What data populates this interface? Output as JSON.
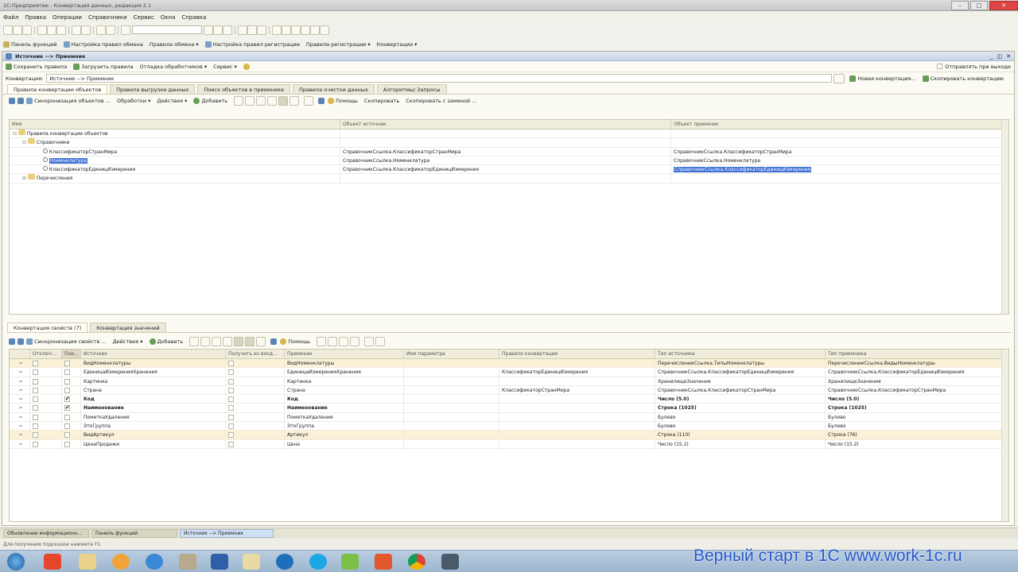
{
  "window": {
    "title": "1С:Предприятие - Конвертация данных, редакция 2.1"
  },
  "menu": [
    "Файл",
    "Правка",
    "Операции",
    "Справочники",
    "Сервис",
    "Окна",
    "Справка"
  ],
  "toolbar2": [
    "Панель функций",
    "Настройка правил обмена",
    "Правила обмена ▾",
    "Настройка правил регистрации",
    "Правила регистрации ▾",
    "Конвертации ▾"
  ],
  "doc": {
    "title": "Источник --> Приемник",
    "actions": [
      "Сохранить правила",
      "Загрузить правила",
      "Отладка обработчиков ▾",
      "Сервис ▾"
    ],
    "send_on_exit": "Отправлять при выходе",
    "conv_label": "Конвертация:",
    "conv_value": "Источник --> Приемник",
    "new_conv": "Новая конвертация...",
    "copy_conv": "Скопировать конвертацию",
    "tabs": [
      "Правила конвертации объектов",
      "Правила выгрузки данных",
      "Поиск объектов в приемнике",
      "Правила очистки данных",
      "Алгоритмы/ Запросы"
    ],
    "tree_toolbar": [
      "Синхронизация объектов ...",
      "Обработки ▾",
      "Действия ▾",
      "Добавить",
      "Помощь",
      "Скопировать",
      "Скопировать с заменой ..."
    ],
    "tree_headers": [
      "Имя",
      "Объект источник",
      "Объект приемник"
    ],
    "tree_rows": [
      {
        "name": "Правила конвертации объектов",
        "src": "",
        "dst": ""
      },
      {
        "name": "Справочники",
        "src": "",
        "dst": ""
      },
      {
        "name": "КлассификаторСтранМира",
        "src": "СправочникСсылка.КлассификаторСтранМира",
        "dst": "СправочникСсылка.КлассификаторСтранМира"
      },
      {
        "name": "Номенклатура",
        "src": "СправочникСсылка.Номенклатура",
        "dst": "СправочникСсылка.Номенклатура"
      },
      {
        "name": "КлассификаторЕдиницИзмерения",
        "src": "СправочникСсылка.КлассификаторЕдиницИзмерения",
        "dst": "СправочникСсылка.КлассификаторЕдиницИзмерения"
      },
      {
        "name": "Перечисления",
        "src": "",
        "dst": ""
      }
    ],
    "bottom_tabs": [
      "Конвертация свойств (7)",
      "Конвертация значений"
    ],
    "prop_toolbar": [
      "Синхронизация свойств ...",
      "Действия ▾",
      "Добавить",
      "Помощь"
    ],
    "prop_headers": [
      "Отключ...",
      "Пои...",
      "Источник",
      "Получить из вход...",
      "Приемник",
      "Имя параметра",
      "Правило конвертации",
      "Тип источника",
      "Тип приемника"
    ],
    "prop_rows": [
      {
        "src": "ВидНоменклатуры",
        "dst": "ВидНоменклатуры",
        "rule": "",
        "tsrc": "ПеречислениеСсылка.ТипыНоменклатуры",
        "tdst": "ПеречислениеСсылка.ВидыНоменклатуры",
        "search": false,
        "bold": false,
        "hl": true
      },
      {
        "src": "ЕдиницаИзмеренияХранения",
        "dst": "ЕдиницаИзмеренияХранения",
        "rule": "КлассификаторЕдиницИзмерения",
        "tsrc": "СправочникСсылка.КлассификаторЕдиницИзмерения",
        "tdst": "СправочникСсылка.КлассификаторЕдиницИзмерения",
        "search": false,
        "bold": false,
        "hl": false
      },
      {
        "src": "Картинка",
        "dst": "Картинка",
        "rule": "",
        "tsrc": "ХранилищеЗначения",
        "tdst": "ХранилищеЗначения",
        "search": false,
        "bold": false,
        "hl": false
      },
      {
        "src": "Страна",
        "dst": "Страна",
        "rule": "КлассификаторСтранМира",
        "tsrc": "СправочникСсылка.КлассификаторСтранМира",
        "tdst": "СправочникСсылка.КлассификаторСтранМира",
        "search": false,
        "bold": false,
        "hl": false
      },
      {
        "src": "Код",
        "dst": "Код",
        "rule": "",
        "tsrc": "Число (5.0)",
        "tdst": "Число (5.0)",
        "search": true,
        "bold": true,
        "hl": false
      },
      {
        "src": "Наименование",
        "dst": "Наименование",
        "rule": "",
        "tsrc": "Строка (1025)",
        "tdst": "Строка (1025)",
        "search": true,
        "bold": true,
        "hl": false
      },
      {
        "src": "ПометкаУдаления",
        "dst": "ПометкаУдаления",
        "rule": "",
        "tsrc": "Булево",
        "tdst": "Булево",
        "search": false,
        "bold": false,
        "hl": false
      },
      {
        "src": "ЭтоГруппа",
        "dst": "ЭтоГруппа",
        "rule": "",
        "tsrc": "Булево",
        "tdst": "Булево",
        "search": false,
        "bold": false,
        "hl": false
      },
      {
        "src": "ВидАртикул",
        "dst": "Артикул",
        "rule": "",
        "tsrc": "Строка (110)",
        "tdst": "Строка (76)",
        "search": false,
        "bold": false,
        "hl": true
      },
      {
        "src": "ЦенаПродажи",
        "dst": "Цена",
        "rule": "",
        "tsrc": "Число (15.2)",
        "tdst": "Число (15.2)",
        "search": false,
        "bold": false,
        "hl": false
      }
    ]
  },
  "windowbar": [
    "Обновление информационн...",
    "Панель функций",
    "Источник --> Приемник"
  ],
  "status": "Для получения подсказки нажмите F1",
  "watermark": "Верный старт в 1С www.work-1c.ru",
  "taskbar": [
    "start",
    "1c-app",
    "explorer",
    "media",
    "ie",
    "tool",
    "users",
    "doc",
    "skype-blue",
    "skype",
    "arrow",
    "office",
    "chrome",
    "plug"
  ]
}
